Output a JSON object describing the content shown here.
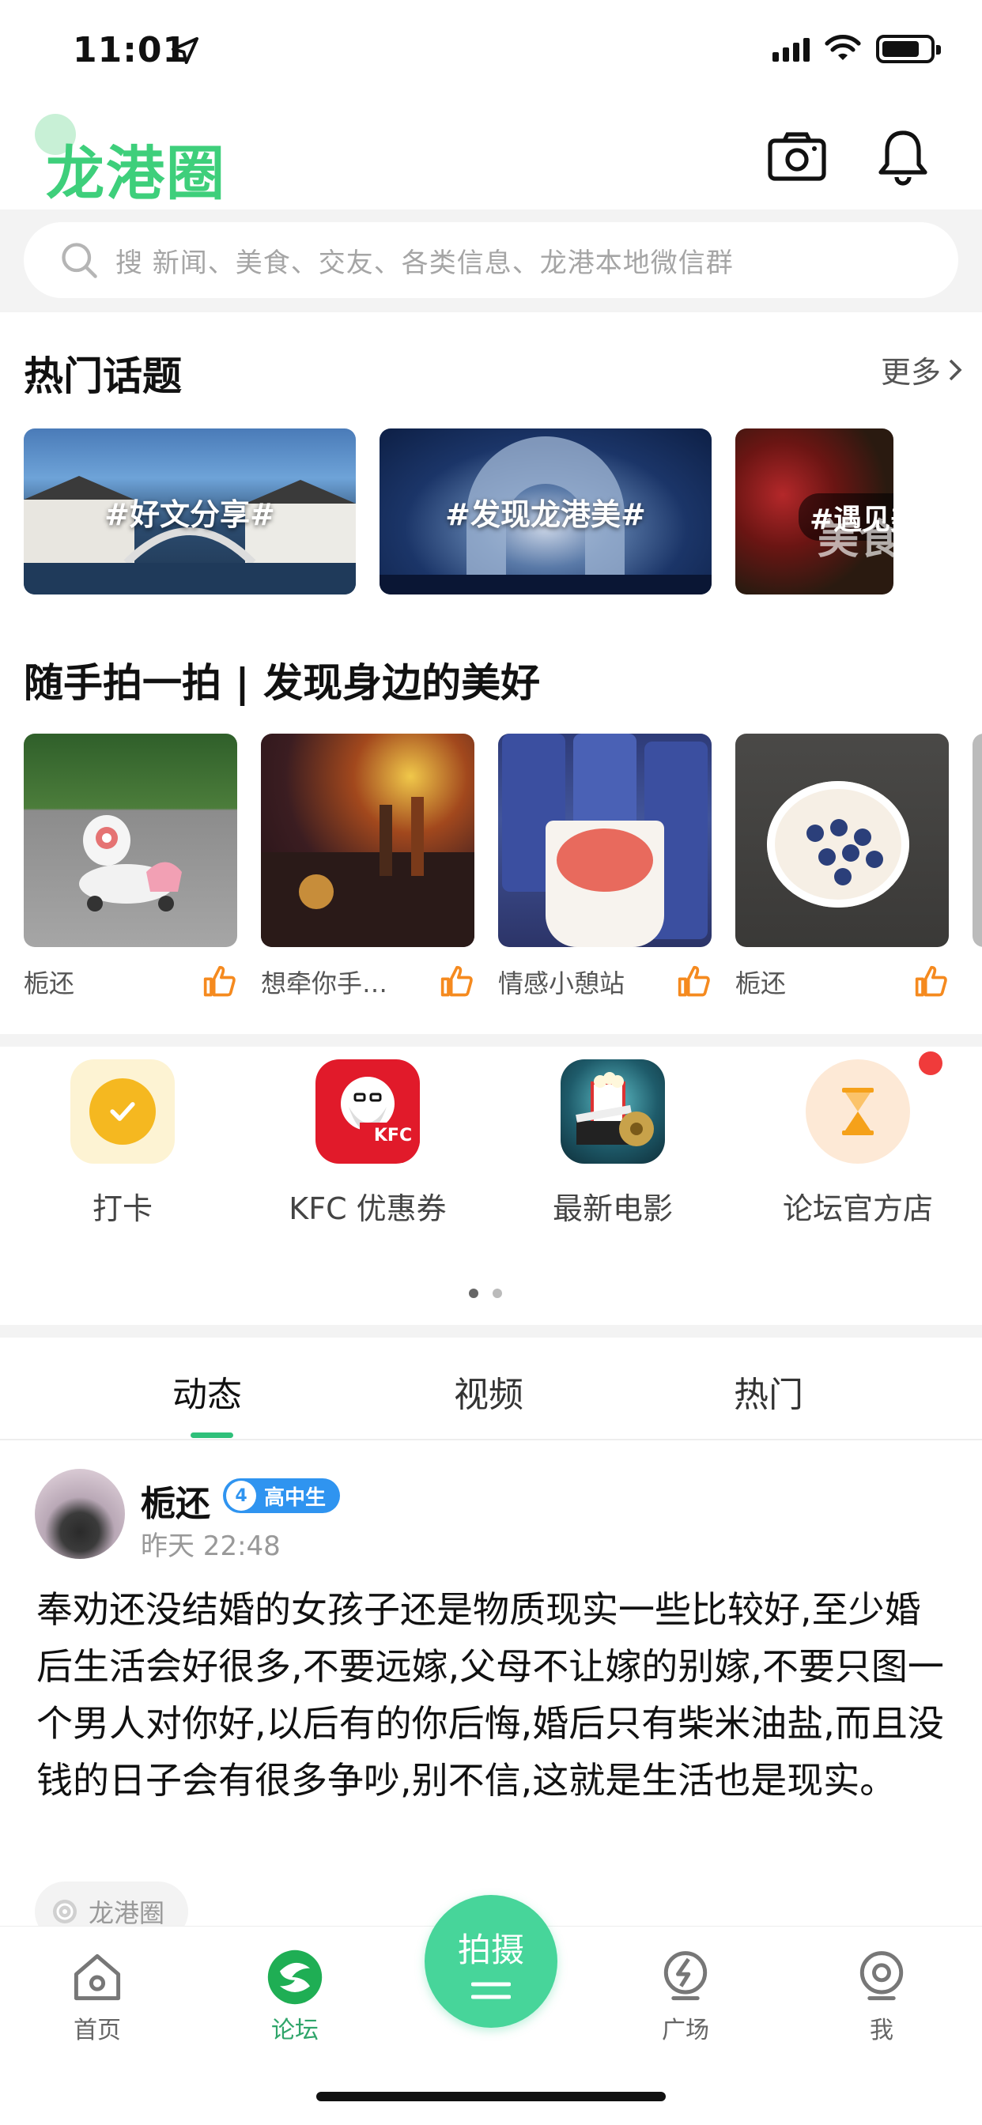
{
  "status_bar": {
    "time": "11:01"
  },
  "header": {
    "app_title": "龙港圈"
  },
  "search": {
    "placeholder": "搜  新闻、美食、交友、各类信息、龙港本地微信群"
  },
  "hot_topics": {
    "title": "热门话题",
    "more_label": "更多",
    "items": [
      {
        "label": "#好文分享#"
      },
      {
        "label": "#发现龙港美#"
      },
      {
        "label": "#遇见美食#",
        "overlay": "美食打卡"
      }
    ]
  },
  "photos": {
    "title": "随手拍一拍 | 发现身边的美好",
    "items": [
      {
        "user": "栀还"
      },
      {
        "user": "想牵你手…"
      },
      {
        "user": "情感小憩站"
      },
      {
        "user": "栀还"
      }
    ]
  },
  "quick_entries": [
    {
      "label": "打卡",
      "icon": "checkmark-icon"
    },
    {
      "label": "KFC 优惠券",
      "icon": "kfc-icon"
    },
    {
      "label": "最新电影",
      "icon": "movie-icon"
    },
    {
      "label": "论坛官方店",
      "icon": "hourglass-icon",
      "has_badge": true
    }
  ],
  "feed_tabs": [
    {
      "label": "动态",
      "active": true
    },
    {
      "label": "视频",
      "active": false
    },
    {
      "label": "热门",
      "active": false
    }
  ],
  "post": {
    "user": "栀还",
    "level": "4",
    "badge": "高中生",
    "time": "昨天 22:48",
    "body": "奉劝还没结婚的女孩子还是物质现实一些比较好,至少婚后生活会好很多,不要远嫁,父母不让嫁的别嫁,不要只图一个男人对你好,以后有的你后悔,婚后只有柴米油盐,而且没钱的日子会有很多争吵,别不信,这就是生活也是现实。",
    "tag": "龙港圈"
  },
  "bottom_nav": {
    "home": "首页",
    "forum": "论坛",
    "shoot": "拍摄",
    "square": "广场",
    "me": "我"
  },
  "colors": {
    "brand_green": "#3ecf7b",
    "shoot_button": "#47d59a",
    "badge_blue": "#2f94f0",
    "notification_red": "#f03b3b"
  }
}
